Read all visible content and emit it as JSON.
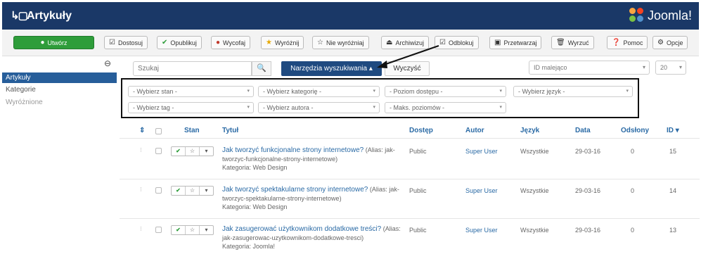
{
  "header": {
    "title": "Artykuły",
    "brand": "Joomla!",
    "brand_colors": [
      "#f9a541",
      "#f44321",
      "#5091cd",
      "#7ac143"
    ]
  },
  "toolbar": {
    "buttons": [
      {
        "id": "new",
        "icon": "plus",
        "label": "Utwórz"
      },
      {
        "id": "edit",
        "icon": "edit",
        "label": "Dostosuj"
      },
      {
        "id": "publish",
        "icon": "check",
        "label": "Opublikuj"
      },
      {
        "id": "unpublish",
        "icon": "x",
        "label": "Wycofaj"
      },
      {
        "id": "feature",
        "icon": "star",
        "label": "Wyróżnij"
      },
      {
        "id": "unfeature",
        "icon": "star-empty",
        "label": "Nie wyróżniaj"
      },
      {
        "id": "archive",
        "icon": "archive",
        "label": "Archiwizuj"
      },
      {
        "id": "checkin",
        "icon": "unlock",
        "label": "Odblokuj"
      },
      {
        "id": "batch",
        "icon": "batch",
        "label": "Przetwarzaj"
      },
      {
        "id": "trash",
        "icon": "trash",
        "label": "Wyrzuć"
      },
      {
        "id": "help",
        "icon": "help",
        "label": "Pomoc"
      },
      {
        "id": "options",
        "icon": "gear",
        "label": "Opcje"
      }
    ]
  },
  "sidebar": {
    "items": [
      "Artykuły",
      "Kategorie",
      "Wyróżnione"
    ]
  },
  "search": {
    "placeholder": "Szukaj",
    "tools_label": "Narzędzia wyszukiwania ▴",
    "clear_label": "Wyczyść",
    "ordering": "ID malejąco",
    "limit": "20"
  },
  "filters": {
    "row1": [
      "- Wybierz stan -",
      "- Wybierz kategorię -",
      "- Poziom dostępu -",
      "- Wybierz język -"
    ],
    "row2": [
      "- Wybierz tag -",
      "- Wybierz autora -",
      "- Maks. poziomów -"
    ]
  },
  "table": {
    "headers": {
      "order": "⇕",
      "status": "Stan",
      "title": "Tytuł",
      "access": "Dostęp",
      "author": "Autor",
      "language": "Język",
      "date": "Data",
      "hits": "Odsłony",
      "id": "ID ▾"
    },
    "rows": [
      {
        "title": "Jak tworzyć funkcjonalne strony internetowe?",
        "alias": " (Alias: jak-tworzyc-funkcjonalne-strony-internetowe)",
        "category": "Kategoria: Web Design",
        "access": "Public",
        "author": "Super User",
        "language": "Wszystkie",
        "date": "29-03-16",
        "hits": "0",
        "id": "15"
      },
      {
        "title": "Jak tworzyć spektakularne strony internetowe?",
        "alias": " (Alias: jak-tworzyc-spektakularne-strony-internetowe)",
        "category": "Kategoria: Web Design",
        "access": "Public",
        "author": "Super User",
        "language": "Wszystkie",
        "date": "29-03-16",
        "hits": "0",
        "id": "14"
      },
      {
        "title": "Jak zasugerować użytkownikom dodatkowe treści?",
        "alias": " (Alias: jak-zasugerowac-uzytkownikom-dodatkowe-tresci)",
        "category": "Kategoria: Joomla!",
        "access": "Public",
        "author": "Super User",
        "language": "Wszystkie",
        "date": "29-03-16",
        "hits": "0",
        "id": "13"
      }
    ]
  }
}
